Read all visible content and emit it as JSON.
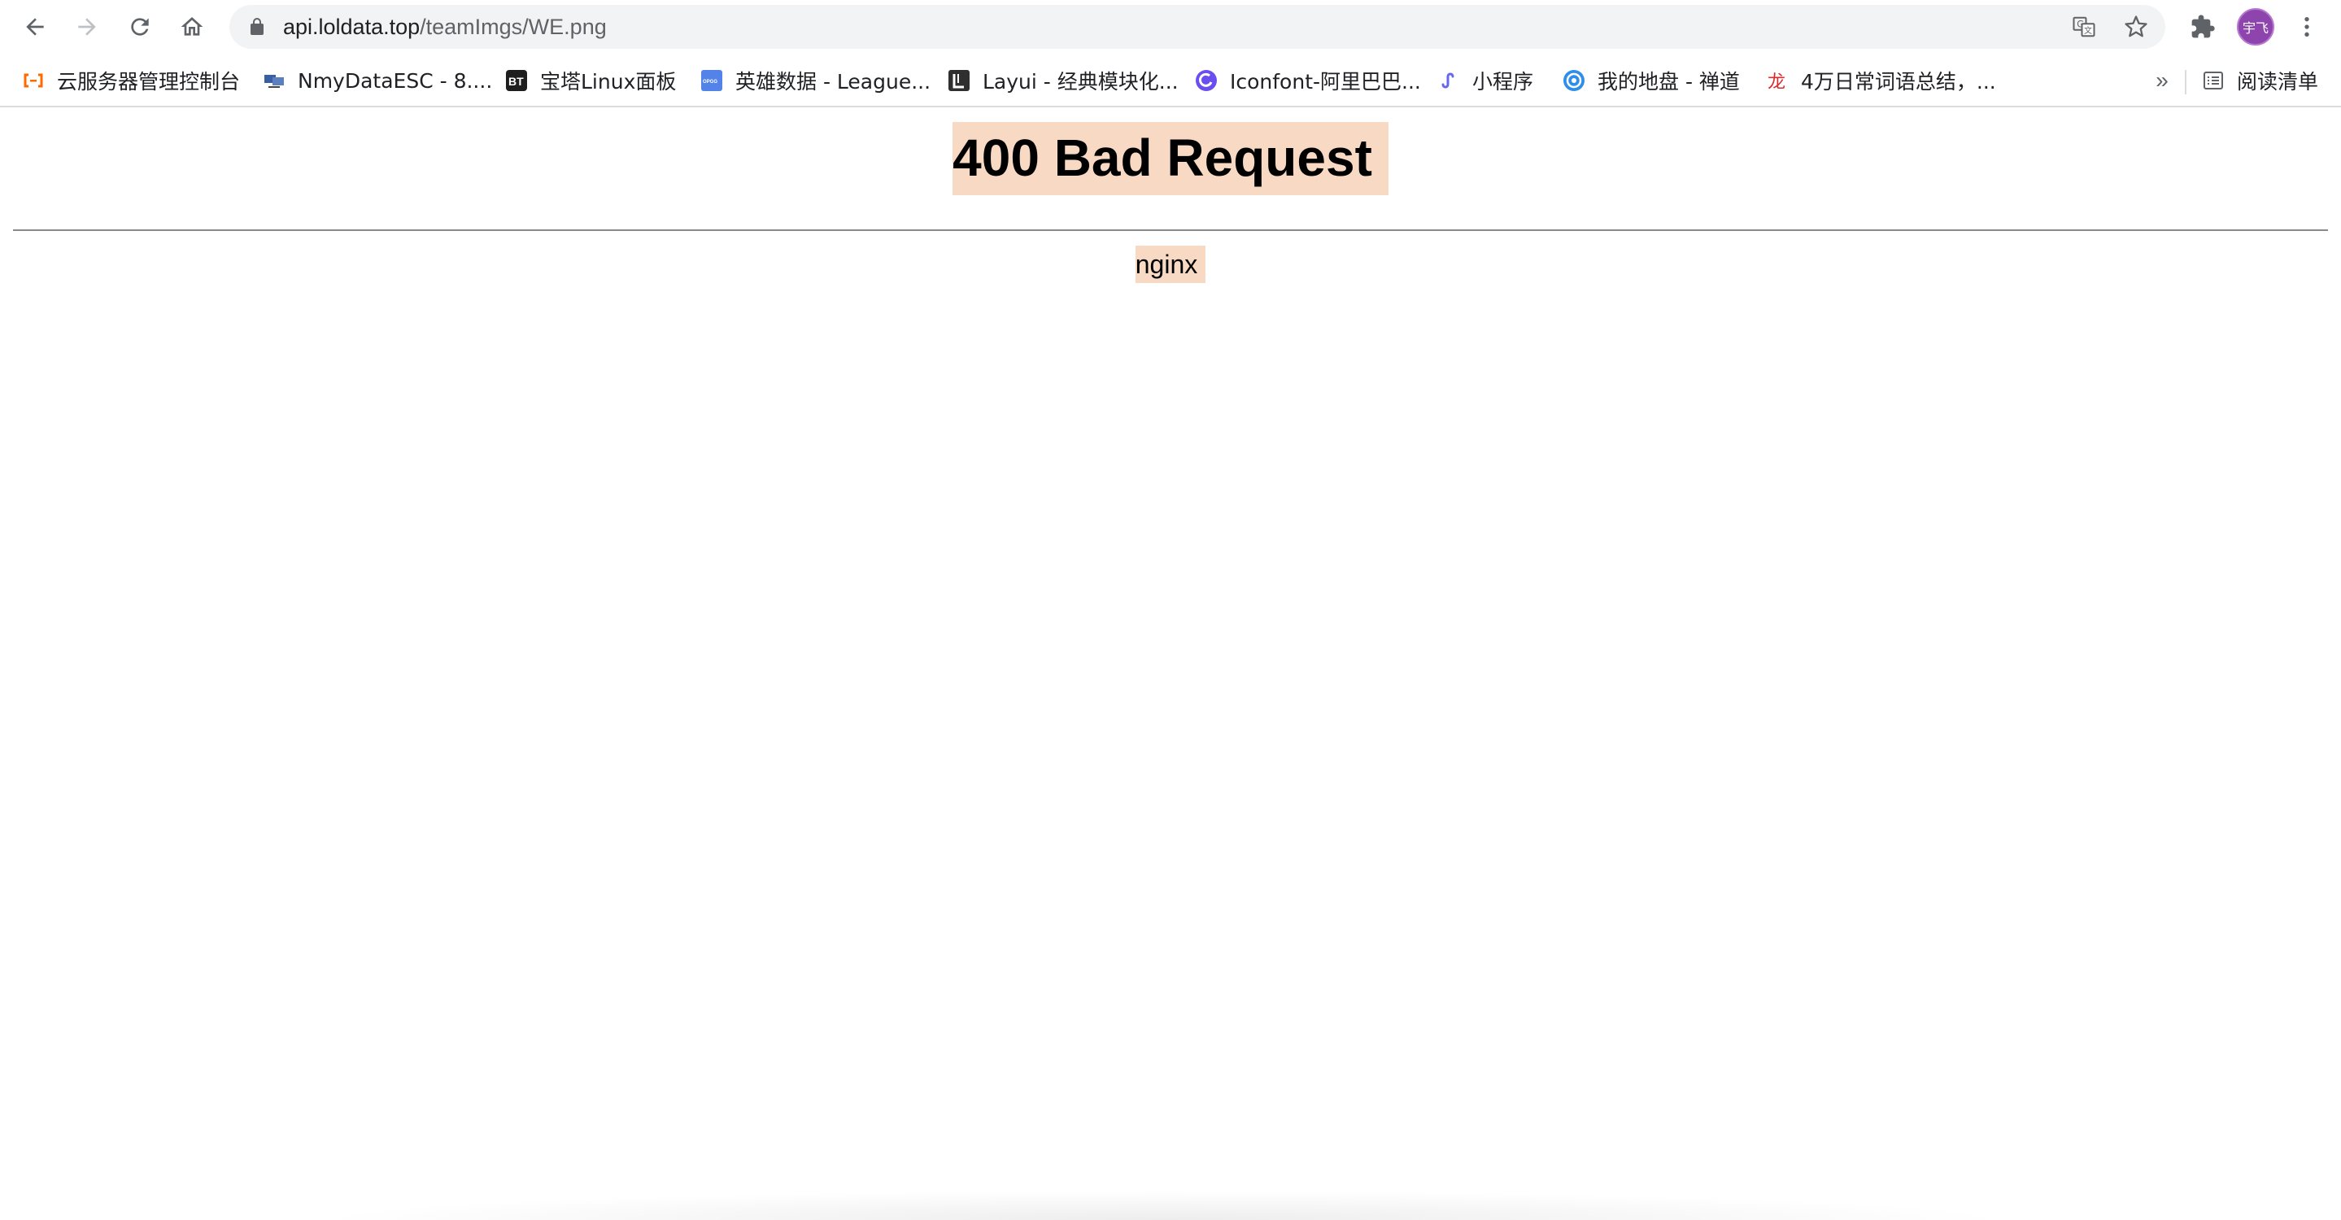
{
  "browser": {
    "url_host": "api.loldata.top",
    "url_path": "/teamImgs/WE.png",
    "avatar_text": "宇飞"
  },
  "bookmarks": [
    {
      "label": "云服务器管理控制台",
      "icon": "aliyun-icon"
    },
    {
      "label": "NmyDataESC - 8....",
      "icon": "monitor-icon"
    },
    {
      "label": "宝塔Linux面板",
      "icon": "bt-icon"
    },
    {
      "label": "英雄数据 - League...",
      "icon": "opgg-icon"
    },
    {
      "label": "Layui - 经典模块化...",
      "icon": "layui-icon"
    },
    {
      "label": "Iconfont-阿里巴巴...",
      "icon": "iconfont-icon"
    },
    {
      "label": "小程序",
      "icon": "miniprogram-icon"
    },
    {
      "label": "我的地盘 - 禅道",
      "icon": "zentao-icon"
    },
    {
      "label": "4万日常词语总结，...",
      "icon": "dragon-icon"
    }
  ],
  "bookmarks_more": "»",
  "reading_list": "阅读清单",
  "page": {
    "title": "400 Bad Request",
    "server": "nginx"
  }
}
